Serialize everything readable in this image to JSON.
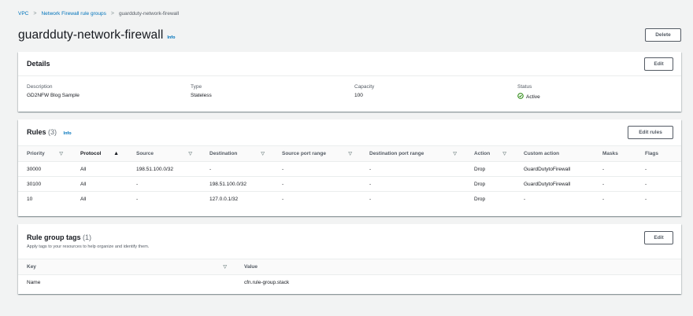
{
  "breadcrumb": {
    "items": [
      "VPC",
      "Network Firewall rule groups"
    ],
    "current": "guardduty-network-firewall",
    "separator": ">"
  },
  "page": {
    "title": "guardduty-network-firewall",
    "info_label": "Info",
    "delete_label": "Delete"
  },
  "details": {
    "title": "Details",
    "edit_label": "Edit",
    "fields": {
      "description": {
        "label": "Description",
        "value": "GD2NFW Blog Sample"
      },
      "type": {
        "label": "Type",
        "value": "Stateless"
      },
      "capacity": {
        "label": "Capacity",
        "value": "100"
      },
      "status": {
        "label": "Status",
        "value": "Active",
        "color": "#1d8102",
        "icon": "check-circle-icon"
      }
    }
  },
  "rules": {
    "title": "Rules",
    "count": "(3)",
    "info_label": "Info",
    "edit_label": "Edit rules",
    "columns": [
      "Priority",
      "Protocol",
      "Source",
      "Destination",
      "Source port range",
      "Destination port range",
      "Action",
      "Custom action",
      "Masks",
      "Flags"
    ],
    "rows": [
      [
        "30000",
        "All",
        "198.51.100.0/32",
        "-",
        "-",
        "-",
        "Drop",
        "GuardDutytoFirewall",
        "-",
        "-"
      ],
      [
        "30100",
        "All",
        "-",
        "198.51.100.0/32",
        "-",
        "-",
        "Drop",
        "GuardDutytoFirewall",
        "-",
        "-"
      ],
      [
        "10",
        "All",
        "-",
        "127.0.0.1/32",
        "-",
        "-",
        "Drop",
        "-",
        "-",
        "-"
      ]
    ]
  },
  "tags": {
    "title": "Rule group tags",
    "count": "(1)",
    "subtitle": "Apply tags to your resources to help organize and identify them.",
    "edit_label": "Edit",
    "columns": [
      "Key",
      "Value"
    ],
    "rows": [
      [
        "Name",
        "cfn.rule-group.stack"
      ]
    ]
  },
  "colors": {
    "link": "#0073bb",
    "background": "#f2f3f3",
    "success": "#1d8102"
  }
}
